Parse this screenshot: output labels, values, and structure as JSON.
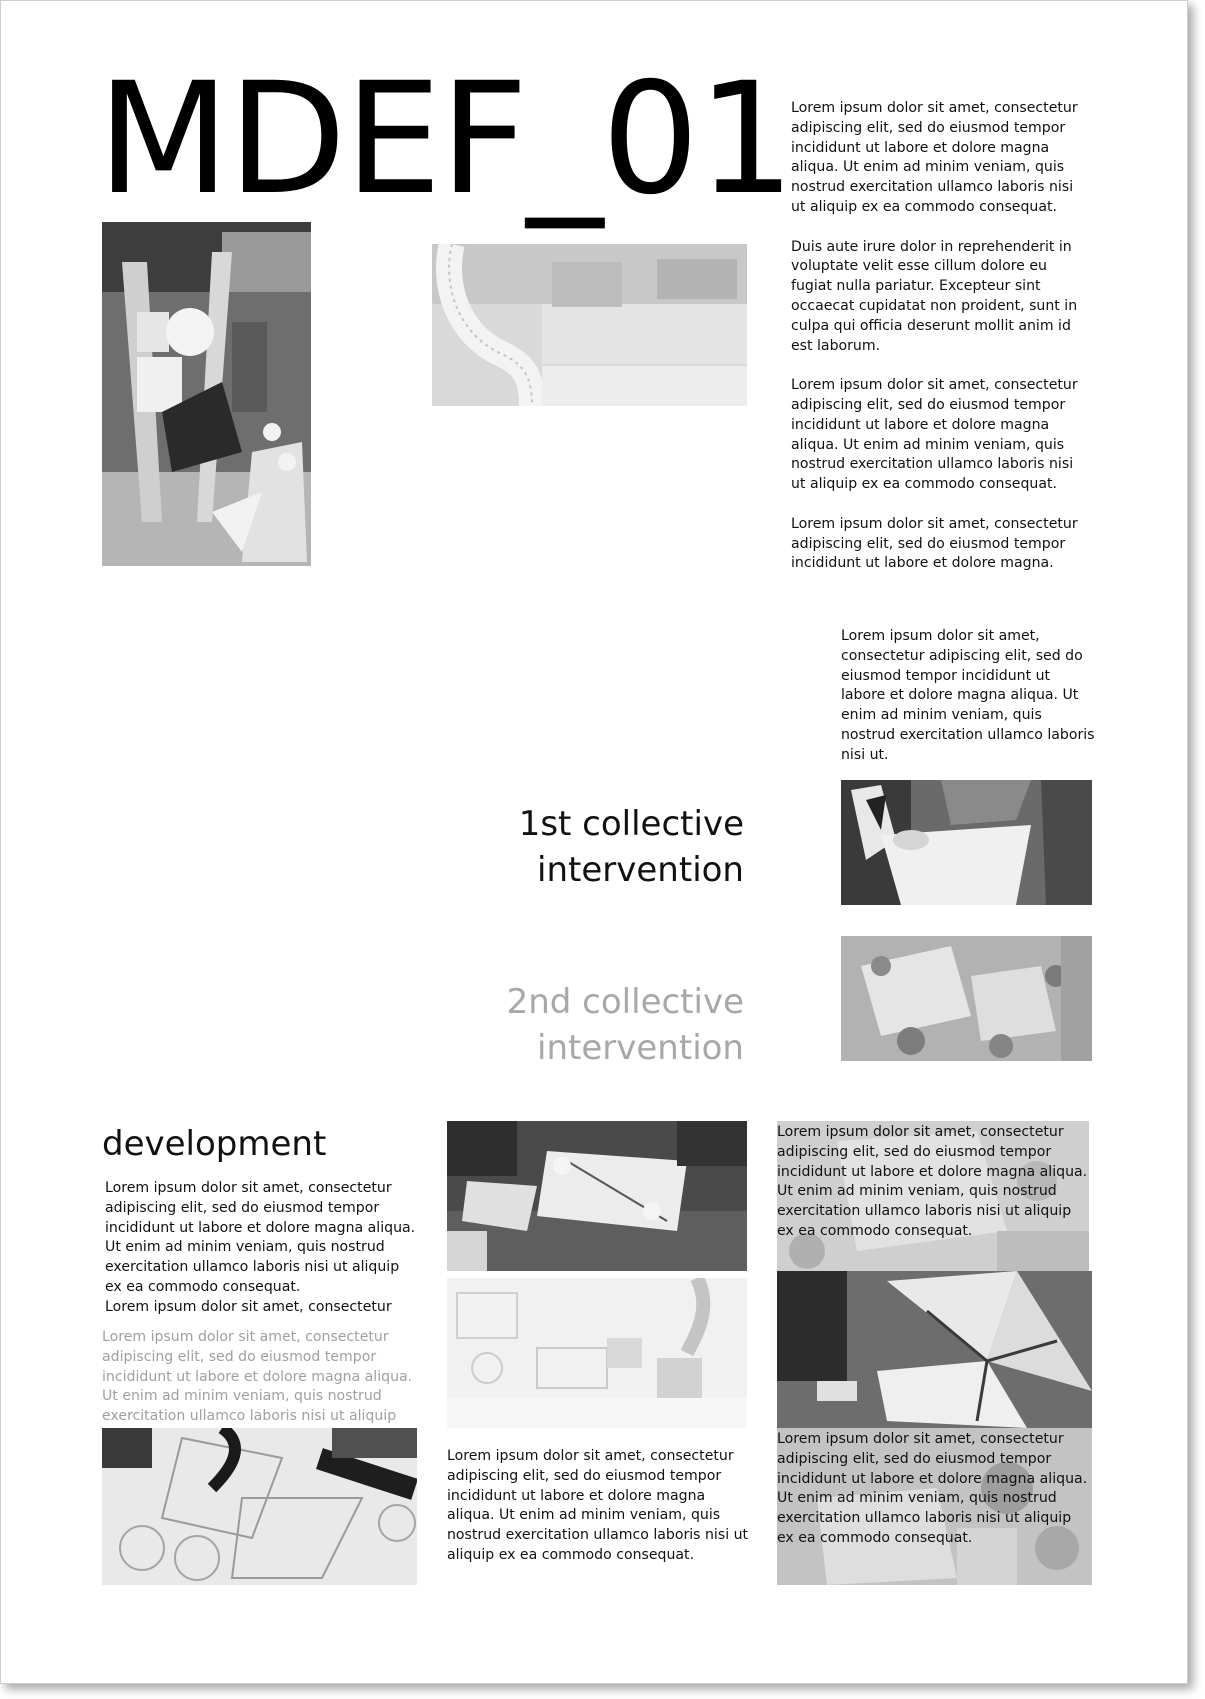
{
  "title": "MDEF_01",
  "right_column": [
    "Lorem ipsum dolor sit amet, consectetur adipiscing elit, sed do eiusmod tempor incididunt ut labore et dolore magna aliqua. Ut enim ad minim veniam, quis nostrud exercitation ullamco laboris nisi ut aliquip ex ea commodo consequat.",
    "Duis aute irure dolor in reprehenderit in voluptate velit esse cillum dolore eu fugiat nulla pariatur. Excepteur sint occaecat cupidatat non proident, sunt in culpa qui officia deserunt mollit anim id est laborum.",
    "Lorem ipsum dolor sit amet, consectetur adipiscing elit, sed do eiusmod tempor incididunt ut labore et dolore magna aliqua. Ut enim ad minim veniam, quis nostrud exercitation ullamco laboris nisi ut aliquip ex ea commodo consequat.",
    "Lorem ipsum dolor sit amet, consectetur adipiscing elit, sed do eiusmod tempor incididunt ut labore et dolore magna."
  ],
  "mid_paragraph": "Lorem ipsum dolor sit amet, consectetur adipiscing elit, sed do eiusmod tempor incididunt ut labore et dolore magna aliqua. Ut enim ad minim veniam, quis nostrud exercitation ullamco laboris nisi ut.",
  "intervention_1": {
    "line1": "1st collective",
    "line2": "intervention"
  },
  "intervention_2": {
    "line1": "2nd collective",
    "line2": "intervention"
  },
  "development": {
    "heading": "development",
    "paragraph": "Lorem ipsum dolor sit amet, consectetur adipiscing elit, sed do eiusmod tempor incididunt ut labore et dolore magna aliqua. Ut enim ad minim veniam, quis nostrud exercitation ullamco laboris nisi ut aliquip ex ea commodo consequat.",
    "paragraph_tail": "Lorem ipsum dolor sit amet, consectetur",
    "faded_paragraph": "Lorem ipsum dolor sit amet, consectetur adipiscing elit, sed do eiusmod tempor incididunt ut labore et dolore magna aliqua. Ut enim ad minim veniam, quis nostrud exercitation ullamco laboris nisi ut aliquip"
  },
  "center_caption": "Lorem ipsum dolor sit amet, consectetur adipiscing elit, sed do eiusmod tempor incididunt ut labore et dolore magna aliqua. Ut enim ad minim veniam, quis nostrud exercitation ullamco laboris nisi ut aliquip ex ea commodo consequat.",
  "overlay_top": "Lorem ipsum dolor sit amet, consectetur adipiscing elit, sed do eiusmod tempor incididunt ut labore et dolore magna aliqua. Ut enim ad minim veniam, quis nostrud exercitation ullamco laboris nisi ut aliquip ex ea commodo consequat.",
  "overlay_bottom": "Lorem ipsum dolor sit amet, consectetur adipiscing elit, sed do eiusmod tempor incididunt ut labore et dolore magna aliqua. Ut enim ad minim veniam, quis nostrud exercitation ullamco laboris nisi ut aliquip ex ea commodo consequat.",
  "colors": {
    "text": "#111111",
    "faded_heading": "#a8a8a8",
    "faded_text": "#a0a0a0"
  }
}
